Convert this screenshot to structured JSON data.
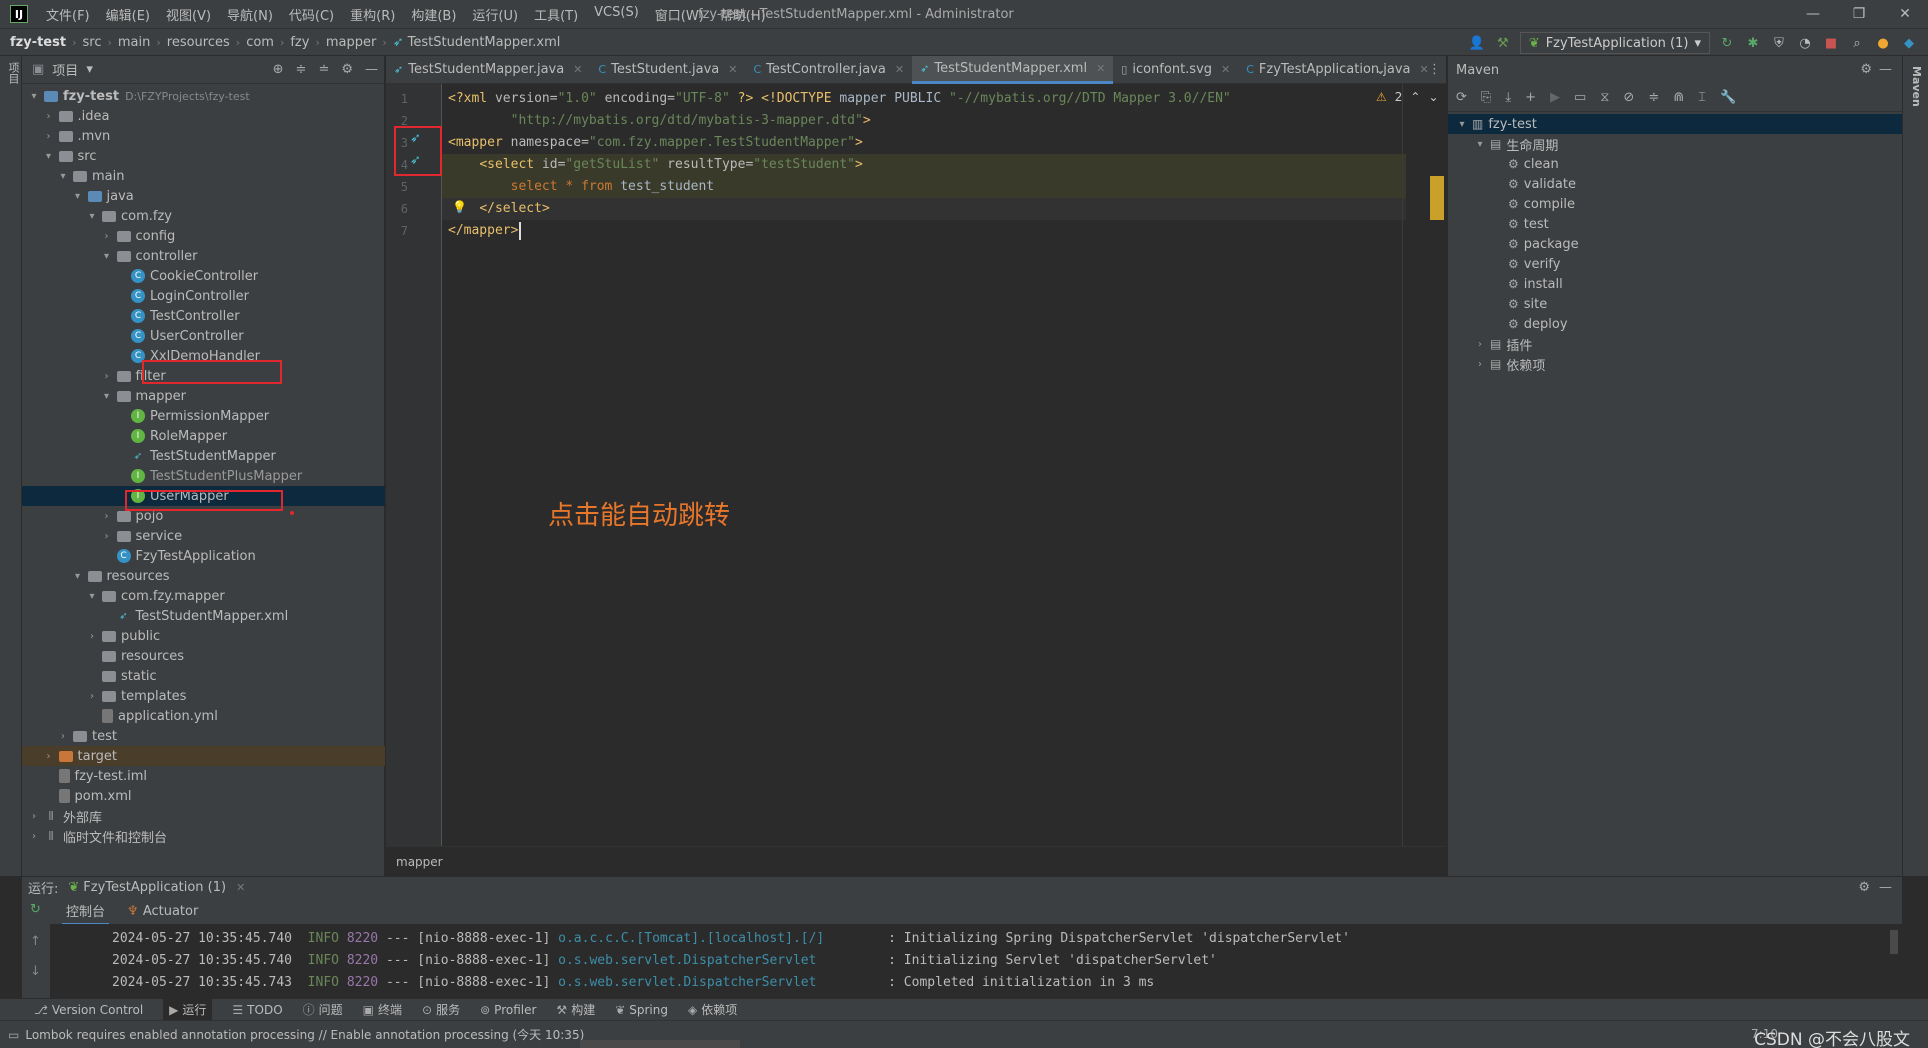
{
  "title_bar": {
    "menu": [
      "文件(F)",
      "编辑(E)",
      "视图(V)",
      "导航(N)",
      "代码(C)",
      "重构(R)",
      "构建(B)",
      "运行(U)",
      "工具(T)",
      "VCS(S)",
      "窗口(W)",
      "帮助(H)"
    ],
    "window_title": "fzy-test - TestStudentMapper.xml - Administrator"
  },
  "nav_bar": {
    "crumbs": [
      "fzy-test",
      "src",
      "main",
      "resources",
      "com",
      "fzy",
      "mapper",
      "TestStudentMapper.xml"
    ],
    "run_config": "FzyTestApplication (1)"
  },
  "left_stripe": {
    "label": "项目"
  },
  "project_panel": {
    "title": "项目",
    "tree": [
      {
        "label": "fzy-test",
        "suffix": "D:\\FZYProjects\\fzy-test"
      },
      {
        "label": ".idea"
      },
      {
        "label": ".mvn"
      },
      {
        "label": "src"
      },
      {
        "label": "main"
      },
      {
        "label": "java"
      },
      {
        "label": "com.fzy"
      },
      {
        "label": "config"
      },
      {
        "label": "controller"
      },
      {
        "label": "CookieController"
      },
      {
        "label": "LoginController"
      },
      {
        "label": "TestController"
      },
      {
        "label": "UserController"
      },
      {
        "label": "XxlDemoHandler"
      },
      {
        "label": "filter"
      },
      {
        "label": "mapper"
      },
      {
        "label": "PermissionMapper"
      },
      {
        "label": "RoleMapper"
      },
      {
        "label": "TestStudentMapper"
      },
      {
        "label": "TestStudentPlusMapper"
      },
      {
        "label": "UserMapper"
      },
      {
        "label": "pojo"
      },
      {
        "label": "service"
      },
      {
        "label": "FzyTestApplication"
      },
      {
        "label": "resources"
      },
      {
        "label": "com.fzy.mapper"
      },
      {
        "label": "TestStudentMapper.xml"
      },
      {
        "label": "public"
      },
      {
        "label": "resources"
      },
      {
        "label": "static"
      },
      {
        "label": "templates"
      },
      {
        "label": "application.yml"
      },
      {
        "label": "test"
      },
      {
        "label": "target"
      },
      {
        "label": "fzy-test.iml"
      },
      {
        "label": "pom.xml"
      },
      {
        "label": "外部库"
      },
      {
        "label": "临时文件和控制台"
      }
    ]
  },
  "editor": {
    "tabs": [
      "TestStudentMapper.java",
      "TestStudent.java",
      "TestController.java",
      "TestStudentMapper.xml",
      "iconfont.svg",
      "FzyTestApplication.java"
    ],
    "active_tab": "TestStudentMapper.xml",
    "warnings": "2",
    "lines": [
      {
        "n": "1",
        "t": "<?xml version=\"1.0\" encoding=\"UTF-8\" ?> <!DOCTYPE mapper PUBLIC \"-//mybatis.org//DTD Mapper 3.0//EN\""
      },
      {
        "n": "2",
        "t": "        \"http://mybatis.org/dtd/mybatis-3-mapper.dtd\">"
      },
      {
        "n": "3",
        "t": "<mapper namespace=\"com.fzy.mapper.TestStudentMapper\">"
      },
      {
        "n": "4",
        "t": "    <select id=\"getStuList\" resultType=\"testStudent\">"
      },
      {
        "n": "5",
        "t": "        select * from test_student"
      },
      {
        "n": "6",
        "t": "    </select>"
      },
      {
        "n": "7",
        "t": "</mapper>"
      }
    ],
    "annotation": "点击能自动跳转",
    "breadcrumb": "mapper"
  },
  "maven": {
    "title": "Maven",
    "project": "fzy-test",
    "lifecycle": "生命周期",
    "phases": [
      "clean",
      "validate",
      "compile",
      "test",
      "package",
      "verify",
      "install",
      "site",
      "deploy"
    ],
    "plugins": "插件",
    "deps": "依赖项"
  },
  "run": {
    "label": "运行:",
    "config": "FzyTestApplication (1)",
    "tabs": [
      "控制台",
      "Actuator"
    ],
    "console": [
      {
        "ts": "2024-05-27 10:35:45.740",
        "lvl": "INFO",
        "pid": "8220",
        "sep": "---",
        "thr": "[nio-8888-exec-1]",
        "cls": "o.a.c.c.C.[Tomcat].[localhost].[/]",
        "msg": ": Initializing Spring DispatcherServlet 'dispatcherServlet'"
      },
      {
        "ts": "2024-05-27 10:35:45.740",
        "lvl": "INFO",
        "pid": "8220",
        "sep": "---",
        "thr": "[nio-8888-exec-1]",
        "cls": "o.s.web.servlet.DispatcherServlet",
        "msg": ": Initializing Servlet 'dispatcherServlet'"
      },
      {
        "ts": "2024-05-27 10:35:45.743",
        "lvl": "INFO",
        "pid": "8220",
        "sep": "---",
        "thr": "[nio-8888-exec-1]",
        "cls": "o.s.web.servlet.DispatcherServlet",
        "msg": ": Completed initialization in 3 ms"
      }
    ]
  },
  "tool_strip": [
    "Version Control",
    "运行",
    "TODO",
    "问题",
    "终端",
    "服务",
    "Profiler",
    "构建",
    "Spring",
    "依赖项"
  ],
  "status": {
    "message": "Lombok requires enabled annotation processing // Enable annotation processing (今天 10:35)",
    "position": "7:10",
    "watermark": "CSDN @不会八股文"
  }
}
